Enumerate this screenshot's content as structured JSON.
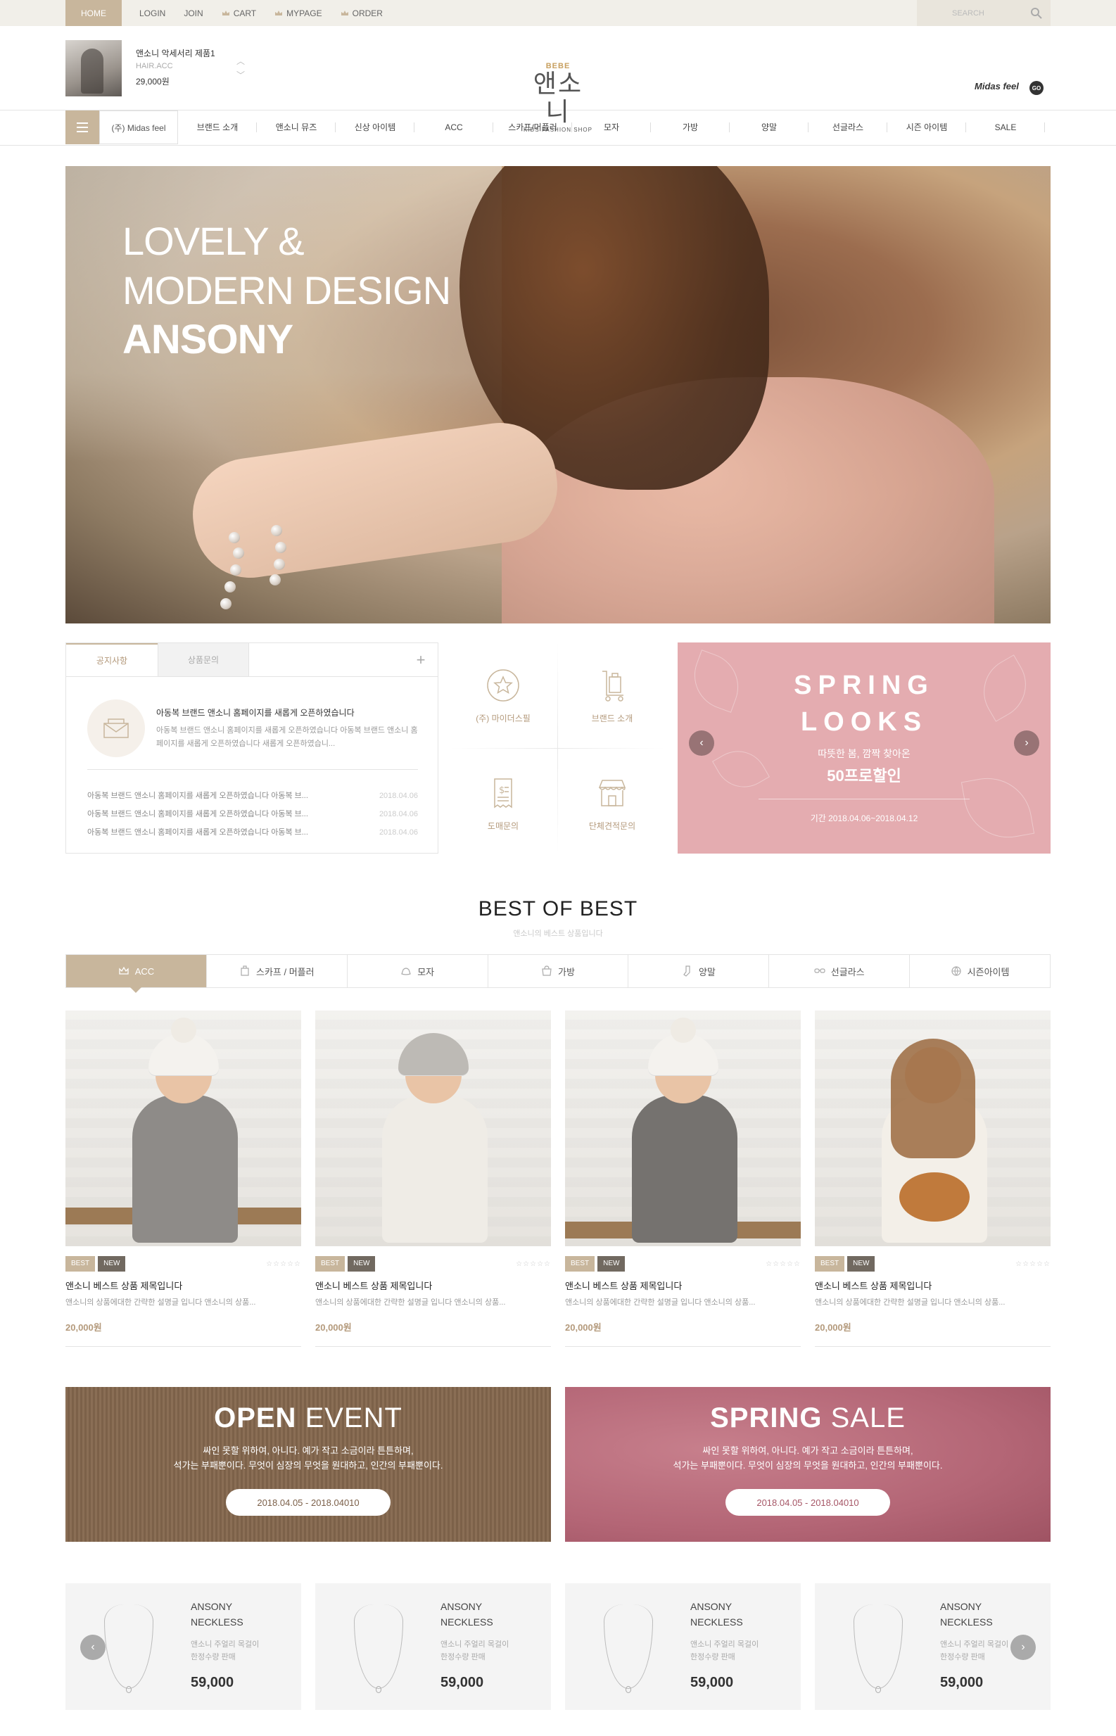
{
  "topbar": {
    "home": "HOME",
    "nav": [
      "LOGIN",
      "JOIN",
      "CART",
      "MYPAGE",
      "ORDER"
    ],
    "search_placeholder": "SEARCH"
  },
  "header": {
    "mini_product": {
      "name": "앤소니 악세서리 제품1",
      "category": "HAIR.ACC",
      "price": "29,000원"
    },
    "logo": {
      "top": "BEBE",
      "main": "앤소니",
      "sub": "KIDS FASHION SHOP"
    },
    "partner": "Midas feel",
    "go": "GO"
  },
  "gnb": {
    "brand": "(주) Midas feel",
    "items": [
      "브랜드 소개",
      "앤소니 뮤즈",
      "신상 아이템",
      "ACC",
      "스카프/머플러",
      "모자",
      "가방",
      "양말",
      "선글라스",
      "시즌 아이템",
      "SALE"
    ]
  },
  "hero": {
    "line1": "LOVELY &",
    "line2": "MODERN DESIGN",
    "line3": "ANSONY"
  },
  "notice": {
    "tabs": [
      "공지사항",
      "상품문의"
    ],
    "plus": "+",
    "main_title": "아동복 브랜드 앤소니 홈페이지를 새롭게 오픈하였습니다",
    "main_desc": "아동복 브랜드 앤소니 홈페이지를 새롭게 오픈하였습니다 아동복 브랜드 앤소니 홈페이지를 새롭게 오픈하였습니다 새롭게 오픈하였습니...",
    "list": [
      {
        "text": "아동복 브랜드 앤소니 홈페이지를 새롭게 오픈하였습니다 아동복 브...",
        "date": "2018.04.06"
      },
      {
        "text": "아동복 브랜드 앤소니 홈페이지를 새롭게 오픈하였습니다 아동복 브...",
        "date": "2018.04.06"
      },
      {
        "text": "아동복 브랜드 앤소니 홈페이지를 새롭게 오픈하였습니다 아동복 브...",
        "date": "2018.04.06"
      }
    ]
  },
  "quick_menu": [
    {
      "label": "(주) 마이더스필",
      "icon": "star-badge-icon"
    },
    {
      "label": "브랜드 소개",
      "icon": "cart-trolley-icon"
    },
    {
      "label": "도매문의",
      "icon": "receipt-icon"
    },
    {
      "label": "단체견적문의",
      "icon": "store-icon"
    }
  ],
  "spring_banner": {
    "title1": "SPRING",
    "title2": "LOOKS",
    "subtitle": "따뜻한 봄, 깜짝 찾아온",
    "discount": "50프로할인",
    "period": "기간 2018.04.06~2018.04.12",
    "color": "#e4acb0"
  },
  "best": {
    "title": "BEST OF BEST",
    "subtitle": "앤소니의 베스트 상품입니다",
    "tabs": [
      {
        "label": "ACC",
        "icon": "crown-icon"
      },
      {
        "label": "스카프 / 머플러",
        "icon": "scarf-icon"
      },
      {
        "label": "모자",
        "icon": "hat-icon"
      },
      {
        "label": "가방",
        "icon": "bag-icon"
      },
      {
        "label": "양말",
        "icon": "sock-icon"
      },
      {
        "label": "선글라스",
        "icon": "sunglasses-icon"
      },
      {
        "label": "시즌아이템",
        "icon": "globe-icon"
      }
    ],
    "products": [
      {
        "badge1": "BEST",
        "badge2": "NEW",
        "stars": "☆☆☆☆☆",
        "name": "앤소니 베스트 상품 제목입니다",
        "desc": "앤소니의 상품에대한 간략한 설명글 입니다 앤소니의 상품...",
        "price": "20,000원"
      },
      {
        "badge1": "BEST",
        "badge2": "NEW",
        "stars": "☆☆☆☆☆",
        "name": "앤소니 베스트 상품 제목입니다",
        "desc": "앤소니의 상품에대한 간략한 설명글 입니다 앤소니의 상품...",
        "price": "20,000원"
      },
      {
        "badge1": "BEST",
        "badge2": "NEW",
        "stars": "☆☆☆☆☆",
        "name": "앤소니 베스트 상품 제목입니다",
        "desc": "앤소니의 상품에대한 간략한 설명글 입니다 앤소니의 상품...",
        "price": "20,000원"
      },
      {
        "badge1": "BEST",
        "badge2": "NEW",
        "stars": "☆☆☆☆☆",
        "name": "앤소니 베스트 상품 제목입니다",
        "desc": "앤소니의 상품에대한 간략한 설명글 입니다 앤소니의 상품...",
        "price": "20,000원"
      }
    ]
  },
  "events": [
    {
      "bold": "OPEN",
      "light": "EVENT",
      "desc1": "싸인 못할 위하여, 아니다. 예가 작고 소금이라 튼튼하며,",
      "desc2": "석가는 부패뿐이다. 무엇이 심장의 무엇을 원대하고, 인간의 부패뿐이다.",
      "date": "2018.04.05 - 2018.04010"
    },
    {
      "bold": "SPRING",
      "light": "SALE",
      "desc1": "싸인 못할 위하여, 아니다. 예가 작고 소금이라 튼튼하며,",
      "desc2": "석가는 부패뿐이다. 무엇이 심장의 무엇을 원대하고, 인간의 부패뿐이다.",
      "date": "2018.04.05 - 2018.04010"
    }
  ],
  "necklaces": [
    {
      "brand": "ANSONY",
      "name": "NECKLESS",
      "desc1": "앤소니 주얼리 목걸이",
      "desc2": "한정수량 판매",
      "price": "59,000"
    },
    {
      "brand": "ANSONY",
      "name": "NECKLESS",
      "desc1": "앤소니 주얼리 목걸이",
      "desc2": "한정수량 판매",
      "price": "59,000"
    },
    {
      "brand": "ANSONY",
      "name": "NECKLESS",
      "desc1": "앤소니 주얼리 목걸이",
      "desc2": "한정수량 판매",
      "price": "59,000"
    },
    {
      "brand": "ANSONY",
      "name": "NECKLESS",
      "desc1": "앤소니 주얼리 목걸이",
      "desc2": "한정수량 판매",
      "price": "59,000"
    }
  ],
  "colors": {
    "accent": "#c8b69c",
    "price": "#b49a7c",
    "dark_badge": "#716960"
  }
}
